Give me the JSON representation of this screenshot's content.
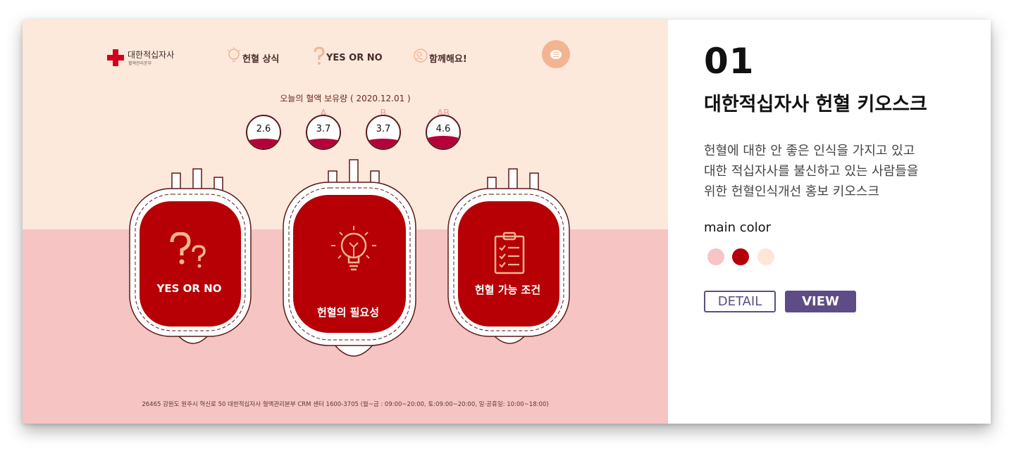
{
  "logo": {
    "name": "대한적십자사",
    "sub": "혈액관리본부"
  },
  "nav": [
    {
      "label": "헌혈 상식",
      "icon": "lightbulb-icon"
    },
    {
      "label": "YES OR NO",
      "icon": "question-icon"
    },
    {
      "label": "함께해요!",
      "icon": "people-icon"
    }
  ],
  "stock": {
    "title": "오늘의 혈액 보유량 ( 2020.12.01 )",
    "types": [
      {
        "type": "",
        "value": "2.6"
      },
      {
        "type": "A",
        "value": "3.7"
      },
      {
        "type": "B",
        "value": "3.7"
      },
      {
        "type": "AB",
        "value": "4.6"
      }
    ]
  },
  "packs": [
    {
      "label": "YES OR NO",
      "icon": "question-icon"
    },
    {
      "label": "헌혈의 필요성",
      "icon": "lightbulb-icon"
    },
    {
      "label": "헌혈 가능 조건",
      "icon": "clipboard-checklist-icon"
    }
  ],
  "footer": "26465 강원도 원주시 혁신로 50 대한적십자사 혈액관리본부 CRM 센터 1600-3705  (월~금 : 09:00~20:00, 토:09:00~20:00, 일·공휴일: 10:00~18:00)",
  "info": {
    "number": "01",
    "title": "대한적십자사 헌혈 키오스크",
    "desc": [
      "헌혈에 대한 안 좋은 인식을 가지고 있고",
      "대한 적십자사를 불신하고 있는 사람들을",
      "위한 헌혈인식개선 홍보 키오스크"
    ],
    "main_color_label": "main color",
    "colors": [
      "#f7c5c6",
      "#b30008",
      "#fde6d8"
    ],
    "detail_label": "DETAIL",
    "view_label": "VIEW"
  }
}
